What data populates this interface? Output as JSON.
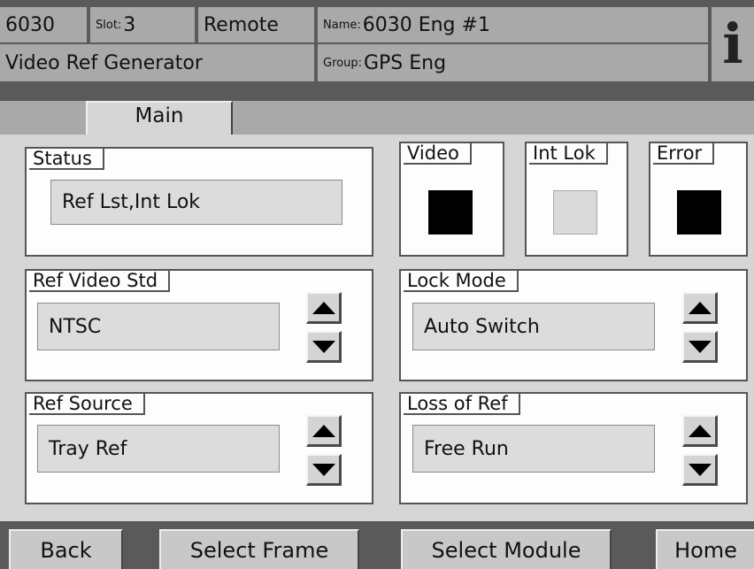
{
  "header": {
    "frame_number": "6030",
    "slot_label": "Slot:",
    "slot_value": "3",
    "mode": "Remote",
    "name_label": "Name:",
    "name_value": "6030 Eng #1",
    "module_type": "Video Ref Generator",
    "group_label": "Group:",
    "group_value": "GPS Eng",
    "info_icon": "i"
  },
  "tabs": [
    {
      "label": "Main",
      "selected": true
    }
  ],
  "status": {
    "legend": "Status",
    "value": "Ref Lst,Int Lok"
  },
  "indicators": [
    {
      "label": "Video",
      "state": "on",
      "color": "#000000"
    },
    {
      "label": "Int Lok",
      "state": "off",
      "color": "#dadada"
    },
    {
      "label": "Error",
      "state": "on",
      "color": "#000000"
    }
  ],
  "controls": {
    "ref_video_std": {
      "legend": "Ref Video Std",
      "value": "NTSC"
    },
    "lock_mode": {
      "legend": "Lock Mode",
      "value": "Auto Switch"
    },
    "ref_source": {
      "legend": "Ref Source",
      "value": "Tray Ref"
    },
    "loss_of_ref": {
      "legend": "Loss of Ref",
      "value": "Free Run"
    }
  },
  "footer": {
    "back": "Back",
    "select_frame": "Select Frame",
    "select_module": "Select Module",
    "home": "Home"
  },
  "colors": {
    "background": "#5a5a5a",
    "header_cell": "#a9a9a9",
    "content": "#d6d6d6",
    "panel": "#fdfdfd",
    "indicator_on": "#000000",
    "indicator_off": "#dadada"
  }
}
